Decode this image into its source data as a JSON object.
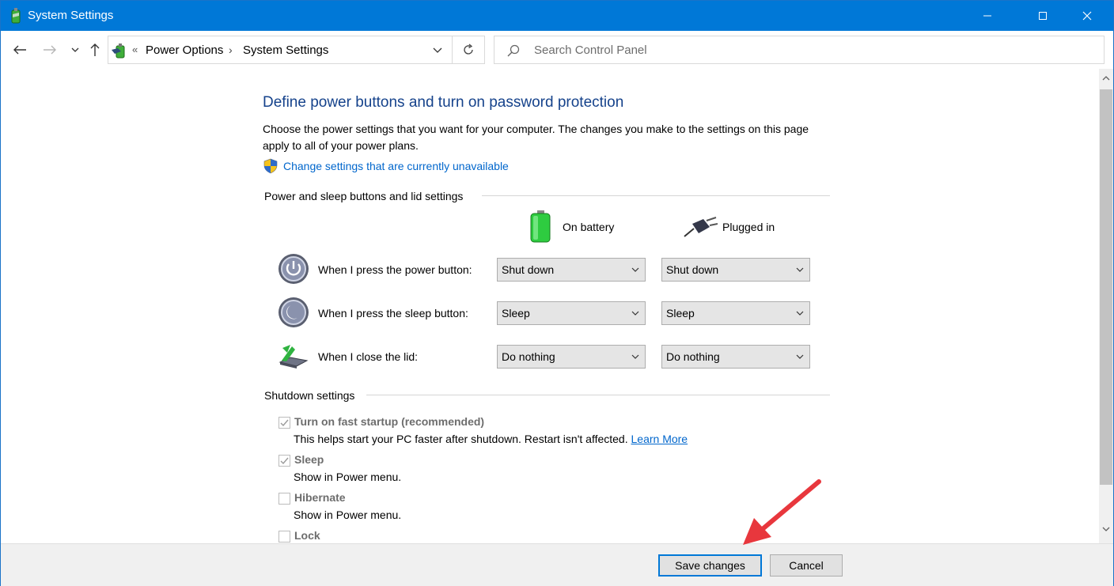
{
  "window": {
    "title": "System Settings",
    "controls": {
      "minimize": "minimize",
      "maximize": "maximize",
      "close": "close"
    }
  },
  "addressbar": {
    "overflow_glyph": "«",
    "breadcrumb": [
      "Power Options",
      "System Settings"
    ],
    "separator": "›",
    "search_placeholder": "Search Control Panel"
  },
  "main": {
    "heading": "Define power buttons and turn on password protection",
    "description": "Choose the power settings that you want for your computer. The changes you make to the settings on this page apply to all of your power plans.",
    "unavailable_link": "Change settings that are currently unavailable",
    "buttons_section_title": "Power and sleep buttons and lid settings",
    "columns": {
      "battery": "On battery",
      "plugged": "Plugged in"
    },
    "rows": [
      {
        "label": "When I press the power button:",
        "battery": "Shut down",
        "plugged": "Shut down"
      },
      {
        "label": "When I press the sleep button:",
        "battery": "Sleep",
        "plugged": "Sleep"
      },
      {
        "label": "When I close the lid:",
        "battery": "Do nothing",
        "plugged": "Do nothing"
      }
    ],
    "shutdown_section_title": "Shutdown settings",
    "shutdown_options": [
      {
        "label": "Turn on fast startup (recommended)",
        "checked": true,
        "sub": "This helps start your PC faster after shutdown. Restart isn't affected.",
        "link": "Learn More"
      },
      {
        "label": "Sleep",
        "checked": true,
        "sub": "Show in Power menu.",
        "link": ""
      },
      {
        "label": "Hibernate",
        "checked": false,
        "sub": "Show in Power menu.",
        "link": ""
      },
      {
        "label": "Lock",
        "checked": false,
        "sub": "",
        "link": ""
      }
    ]
  },
  "footer": {
    "save_label": "Save changes",
    "cancel_label": "Cancel"
  },
  "colors": {
    "titlebar": "#0078d7",
    "heading": "#15428b",
    "link": "#0066cc",
    "annotation_arrow": "#e8373d"
  },
  "icons": [
    "app-power-icon",
    "back-arrow-icon",
    "forward-arrow-icon",
    "recent-chevron-icon",
    "up-arrow-icon",
    "refresh-icon",
    "search-icon",
    "uac-shield-icon",
    "battery-icon",
    "plug-icon",
    "power-button-icon",
    "sleep-button-icon",
    "lid-close-icon",
    "checkmark-icon",
    "red-annotation-arrow"
  ]
}
